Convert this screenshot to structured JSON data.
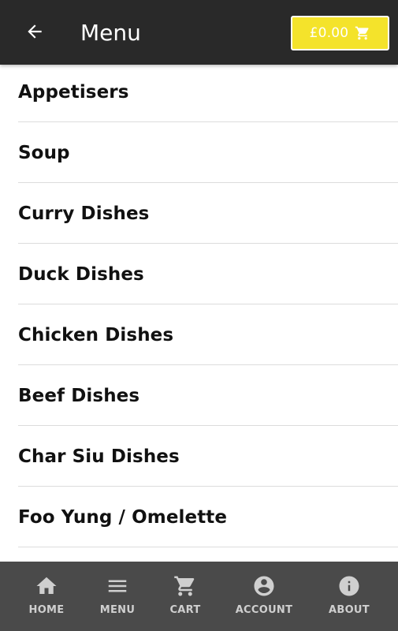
{
  "header": {
    "title": "Menu",
    "back_icon": "arrow-left-icon",
    "cart": {
      "total": "£0.00",
      "icon": "cart-icon",
      "background": "#f4e32b"
    },
    "background": "#292929"
  },
  "menu": {
    "categories": [
      {
        "label": "Appetisers"
      },
      {
        "label": "Soup"
      },
      {
        "label": "Curry Dishes"
      },
      {
        "label": "Duck Dishes"
      },
      {
        "label": "Chicken Dishes"
      },
      {
        "label": "Beef Dishes"
      },
      {
        "label": "Char Siu Dishes"
      },
      {
        "label": "Foo Yung / Omelette"
      }
    ]
  },
  "bottom_nav": {
    "background": "#4a4a4a",
    "items": [
      {
        "label": "HOME",
        "icon": "home-icon"
      },
      {
        "label": "MENU",
        "icon": "hamburger-menu-icon"
      },
      {
        "label": "CART",
        "icon": "cart-icon"
      },
      {
        "label": "ACCOUNT",
        "icon": "account-circle-icon"
      },
      {
        "label": "ABOUT",
        "icon": "info-icon"
      }
    ]
  }
}
